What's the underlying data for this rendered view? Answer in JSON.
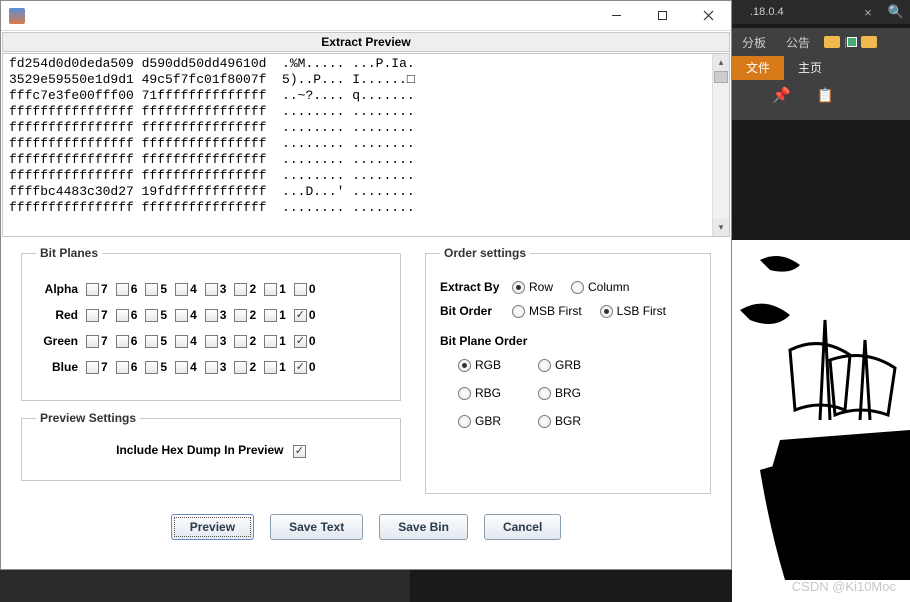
{
  "bg": {
    "ip": ".18.0.4",
    "tab1": "分板",
    "tab2": "公告",
    "subtab_file": "文件",
    "subtab_home": "主页",
    "watermark": "CSDN @Ki10Moc"
  },
  "dialog": {
    "header": "Extract Preview",
    "hexdump": "fd254d0d0deda509 d590dd50dd49610d  .%M..... ...P.Ia.\n3529e59550e1d9d1 49c5f7fc01f8007f  5)..P... I......□\nfffc7e3fe00fff00 71ffffffffffffff  ..~?.... q.......\nffffffffffffffff ffffffffffffffff  ........ ........\nffffffffffffffff ffffffffffffffff  ........ ........\nffffffffffffffff ffffffffffffffff  ........ ........\nffffffffffffffff ffffffffffffffff  ........ ........\nffffffffffffffff ffffffffffffffff  ........ ........\nffffbc4483c30d27 19fdffffffffffff  ...D...' ........\nffffffffffffffff ffffffffffffffff  ........ ........",
    "bitplanes_legend": "Bit Planes",
    "channels": [
      "Alpha",
      "Red",
      "Green",
      "Blue"
    ],
    "bits": [
      "7",
      "6",
      "5",
      "4",
      "3",
      "2",
      "1",
      "0"
    ],
    "checked": {
      "Alpha": [],
      "Red": [
        "0"
      ],
      "Green": [
        "0"
      ],
      "Blue": [
        "0"
      ]
    },
    "preview_legend": "Preview Settings",
    "preview_label": "Include Hex Dump In Preview",
    "preview_checked": true,
    "order_legend": "Order settings",
    "extract_by_label": "Extract By",
    "extract_by_opts": [
      "Row",
      "Column"
    ],
    "extract_by_sel": "Row",
    "bit_order_label": "Bit Order",
    "bit_order_opts": [
      "MSB First",
      "LSB First"
    ],
    "bit_order_sel": "LSB First",
    "bp_order_label": "Bit Plane Order",
    "bp_order_opts": [
      "RGB",
      "GRB",
      "RBG",
      "BRG",
      "GBR",
      "BGR"
    ],
    "bp_order_sel": "RGB",
    "buttons": {
      "preview": "Preview",
      "save_text": "Save Text",
      "save_bin": "Save Bin",
      "cancel": "Cancel"
    }
  }
}
